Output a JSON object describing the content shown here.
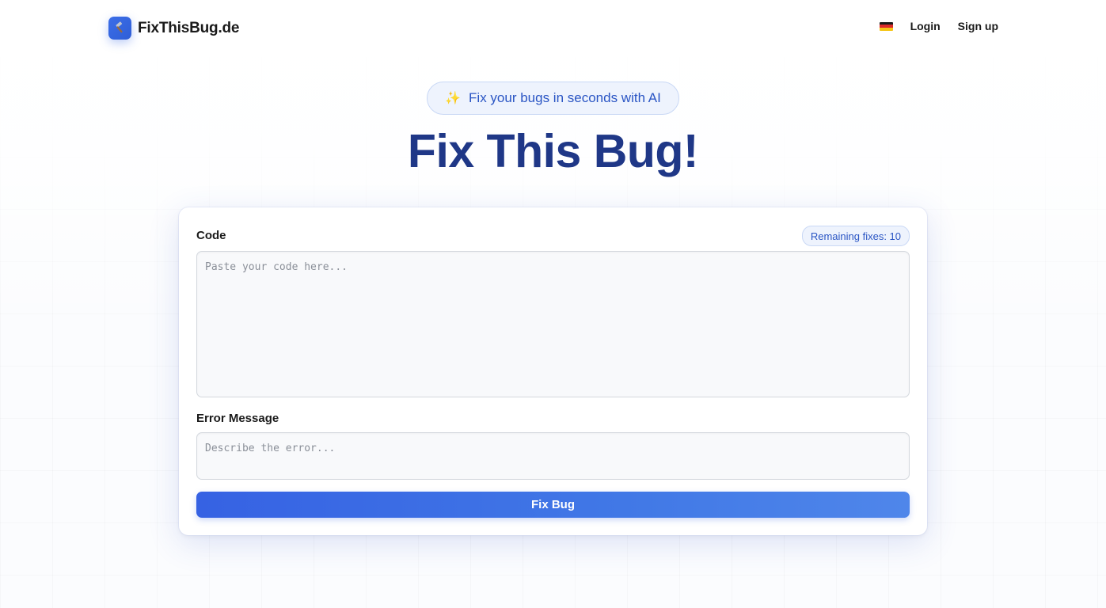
{
  "brand": {
    "name": "FixThisBug.de",
    "logo_icon": "hammer-icon"
  },
  "nav": {
    "language_icon": "german-flag-icon",
    "login": "Login",
    "signup": "Sign up"
  },
  "hero": {
    "pill_icon": "sparkles-icon",
    "pill_text": "Fix your bugs in seconds with AI",
    "title": "Fix This Bug!"
  },
  "form": {
    "code_label": "Code",
    "remaining_fixes": "Remaining fixes: 10",
    "code_placeholder": "Paste your code here...",
    "error_label": "Error Message",
    "error_placeholder": "Describe the error...",
    "submit_label": "Fix Bug"
  },
  "colors": {
    "accent": "#3662e3",
    "title": "#1f3787",
    "pill_text": "#2a55c4"
  }
}
